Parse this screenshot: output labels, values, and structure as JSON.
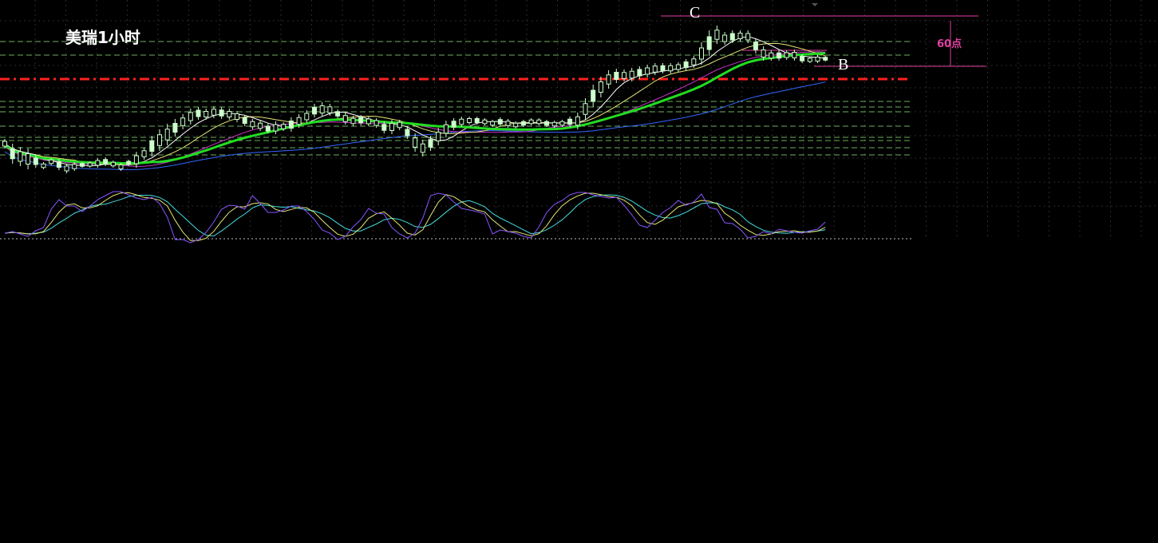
{
  "chart_data": {
    "type": "candlestick",
    "title": "美瑞1小时",
    "annotations": {
      "peak_label": "C",
      "low_label": "B",
      "range_label": "60点"
    },
    "grid": true,
    "colors": {
      "background": "#000000",
      "candle": "#ccffcc",
      "ma_fast": "#ffffff",
      "ma_medium": "#e6e676",
      "ma_slow": "#cc33cc",
      "ma_main": "#22dd22",
      "ma_long": "#3366ff",
      "resistance": "#ff2020",
      "support_levels": "#7fd16f",
      "annotation": "#e040a0",
      "osc_k": "#8855ff",
      "osc_d": "#e6e676",
      "osc_j": "#44dddd"
    },
    "candles": [
      [
        0,
        174,
        186
      ],
      [
        1,
        180,
        205
      ],
      [
        2,
        184,
        208
      ],
      [
        3,
        186,
        212
      ],
      [
        4,
        194,
        210
      ],
      [
        5,
        203,
        212
      ],
      [
        6,
        198,
        207
      ],
      [
        7,
        199,
        213
      ],
      [
        8,
        205,
        217
      ],
      [
        9,
        203,
        214
      ],
      [
        10,
        203,
        210
      ],
      [
        11,
        202,
        210
      ],
      [
        12,
        198,
        210
      ],
      [
        13,
        197,
        208
      ],
      [
        14,
        201,
        210
      ],
      [
        15,
        204,
        214
      ],
      [
        16,
        200,
        208
      ],
      [
        17,
        190,
        210
      ],
      [
        18,
        185,
        200
      ],
      [
        19,
        170,
        196
      ],
      [
        20,
        162,
        189
      ],
      [
        21,
        155,
        182
      ],
      [
        22,
        149,
        171
      ],
      [
        23,
        143,
        162
      ],
      [
        24,
        136,
        156
      ],
      [
        25,
        134,
        150
      ],
      [
        26,
        136,
        150
      ],
      [
        27,
        133,
        148
      ],
      [
        28,
        134,
        149
      ],
      [
        29,
        136,
        150
      ],
      [
        30,
        139,
        153
      ],
      [
        31,
        144,
        158
      ],
      [
        32,
        149,
        162
      ],
      [
        33,
        151,
        164
      ],
      [
        34,
        155,
        167
      ],
      [
        35,
        152,
        168
      ],
      [
        36,
        153,
        164
      ],
      [
        37,
        147,
        165
      ],
      [
        38,
        143,
        160
      ],
      [
        39,
        138,
        154
      ],
      [
        40,
        130,
        147
      ],
      [
        41,
        128,
        146
      ],
      [
        42,
        130,
        145
      ],
      [
        43,
        137,
        148
      ],
      [
        44,
        141,
        156
      ],
      [
        45,
        145,
        158
      ],
      [
        46,
        144,
        157
      ],
      [
        47,
        146,
        158
      ],
      [
        48,
        148,
        160
      ],
      [
        49,
        152,
        167
      ],
      [
        50,
        150,
        168
      ],
      [
        51,
        150,
        163
      ],
      [
        52,
        158,
        174
      ],
      [
        53,
        167,
        190
      ],
      [
        54,
        175,
        196
      ],
      [
        55,
        170,
        189
      ],
      [
        56,
        160,
        182
      ],
      [
        57,
        151,
        172
      ],
      [
        58,
        148,
        163
      ],
      [
        59,
        146,
        159
      ],
      [
        60,
        146,
        156
      ],
      [
        61,
        146,
        156
      ],
      [
        62,
        148,
        157
      ],
      [
        63,
        150,
        159
      ],
      [
        64,
        147,
        158
      ],
      [
        65,
        149,
        160
      ],
      [
        66,
        152,
        161
      ],
      [
        67,
        150,
        159
      ],
      [
        68,
        148,
        157
      ],
      [
        69,
        148,
        157
      ],
      [
        70,
        150,
        159
      ],
      [
        71,
        151,
        160
      ],
      [
        72,
        150,
        159
      ],
      [
        73,
        146,
        159
      ],
      [
        74,
        141,
        162
      ],
      [
        75,
        123,
        150
      ],
      [
        76,
        106,
        134
      ],
      [
        77,
        96,
        122
      ],
      [
        78,
        88,
        111
      ],
      [
        79,
        86,
        104
      ],
      [
        80,
        87,
        102
      ],
      [
        81,
        85,
        102
      ],
      [
        82,
        83,
        99
      ],
      [
        83,
        81,
        97
      ],
      [
        84,
        79,
        94
      ],
      [
        85,
        79,
        92
      ],
      [
        86,
        79,
        92
      ],
      [
        87,
        78,
        90
      ],
      [
        88,
        74,
        88
      ],
      [
        89,
        70,
        85
      ],
      [
        90,
        53,
        81
      ],
      [
        91,
        38,
        70
      ],
      [
        92,
        32,
        55
      ],
      [
        93,
        40,
        56
      ],
      [
        94,
        38,
        54
      ],
      [
        95,
        38,
        52
      ],
      [
        96,
        38,
        54
      ],
      [
        97,
        48,
        67
      ],
      [
        98,
        58,
        76
      ],
      [
        99,
        63,
        76
      ],
      [
        100,
        63,
        76
      ],
      [
        101,
        63,
        75
      ],
      [
        102,
        62,
        76
      ],
      [
        103,
        68,
        79
      ],
      [
        104,
        71,
        79
      ],
      [
        105,
        69,
        79
      ],
      [
        106,
        70,
        77
      ]
    ],
    "oscillator": {
      "k": [
        292,
        290,
        293,
        296,
        289,
        285,
        262,
        250,
        258,
        258,
        265,
        258,
        250,
        245,
        240,
        240,
        244,
        248,
        250,
        247,
        255,
        272,
        300,
        300,
        304,
        300,
        291,
        278,
        262,
        257,
        258,
        262,
        245,
        255,
        266,
        266,
        263,
        258,
        258,
        265,
        275,
        288,
        292,
        300,
        296,
        284,
        275,
        261,
        267,
        268,
        285,
        293,
        298,
        292,
        273,
        245,
        242,
        244,
        253,
        261,
        263,
        265,
        268,
        293,
        288,
        290,
        292,
        296,
        298,
        284,
        266,
        256,
        251,
        244,
        241,
        241,
        244,
        246,
        248,
        247,
        257,
        269,
        282,
        285,
        276,
        266,
        260,
        251,
        257,
        253,
        243,
        260,
        262,
        279,
        280,
        287,
        298,
        296,
        290,
        293,
        287,
        289,
        291,
        292,
        289,
        287,
        278
      ]
    }
  }
}
